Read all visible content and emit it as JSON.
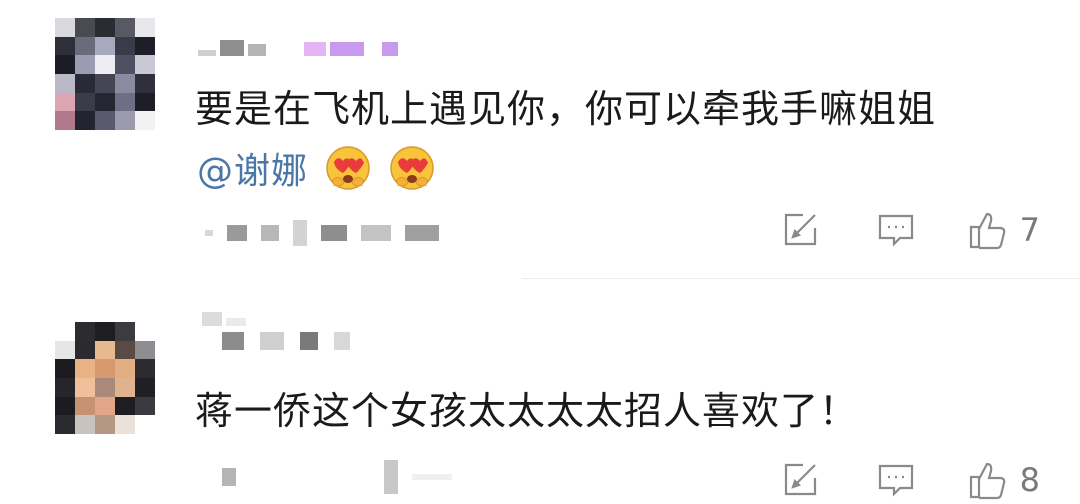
{
  "comments": [
    {
      "text": "要是在飞机上遇见你，你可以牵我手嘛姐姐",
      "mention": "@谢娜",
      "emojis": [
        "heart-eyes-emoji",
        "heart-eyes-emoji"
      ],
      "likes": "7",
      "accent_colors": {
        "name_tag": "#c79af0",
        "mention": "#4b77a7"
      }
    },
    {
      "text": "蒋一侨这个女孩太太太太招人喜欢了！",
      "likes": "8"
    }
  ],
  "icons": {
    "share": "share-icon",
    "comment": "comment-icon",
    "like": "thumbs-up-icon"
  }
}
